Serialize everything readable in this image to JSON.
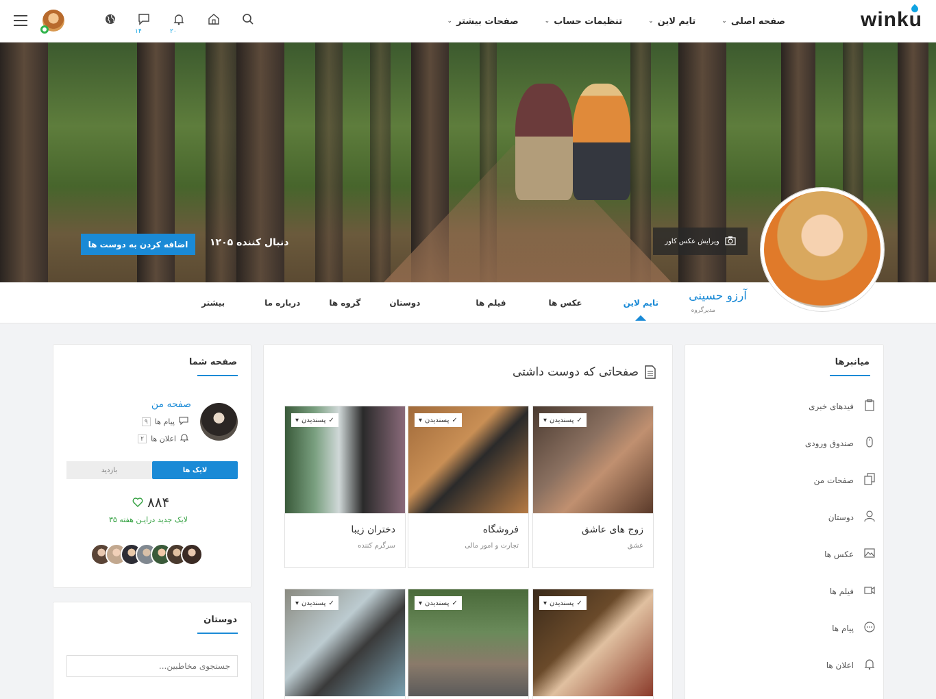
{
  "header": {
    "logo": "winku",
    "nav": [
      {
        "label": "صفحه اصلی"
      },
      {
        "label": "تایم لاین"
      },
      {
        "label": "تنظیمات حساب"
      },
      {
        "label": "صفحات بیشتر"
      }
    ],
    "icons": [
      "search-icon",
      "home-icon",
      "bell-icon",
      "chat-icon",
      "globe-icon"
    ],
    "notification_count": "۲۰",
    "message_count": "۱۴"
  },
  "cover": {
    "followers": "۱۲۰۵ دنبال کننده",
    "add_friend_label": "اضافه کردن به دوست ها",
    "edit_cover_label": "ویرایش عکس کاور"
  },
  "profile": {
    "name": "آرزو حسینی",
    "role": "مدیرگروه",
    "tabs": [
      "تایم لاین",
      "عکس ها",
      "فیلم ها",
      "دوستان",
      "گروه ها",
      "درباره ما",
      "بیشتر"
    ],
    "active_tab": "تایم لاین"
  },
  "your_page": {
    "title": "صفحه شما",
    "my_page_link": "صفحه من",
    "messages_label": "پیام ها",
    "messages_count": "۹",
    "notifications_label": "اعلان ها",
    "notifications_count": "۲",
    "toggle_on": "لایک ها",
    "toggle_off": "بازدید",
    "likes_total": "۸۸۴",
    "likes_new": "۳۵ لایک جدید درایـن هفته"
  },
  "friends": {
    "title": "دوستان",
    "search_placeholder": "جستجوی مخاطبین..."
  },
  "liked_pages": {
    "title": "صفحاتی که دوست داشتی",
    "like_tag": "پسندیدن",
    "pages": [
      {
        "title": "زوج های عاشق",
        "subtitle": "عشق"
      },
      {
        "title": "فروشگاه",
        "subtitle": "تجارت و امور مالی"
      },
      {
        "title": "دختران زیبا",
        "subtitle": "سرگرم کننده"
      },
      {
        "title": "",
        "subtitle": ""
      },
      {
        "title": "",
        "subtitle": ""
      },
      {
        "title": "",
        "subtitle": ""
      }
    ]
  },
  "shortcuts": {
    "title": "میانبرها",
    "items": [
      {
        "label": "فیدهای خبری",
        "icon": "clipboard-icon"
      },
      {
        "label": "صندوق ورودی",
        "icon": "mouse-icon"
      },
      {
        "label": "صفحات من",
        "icon": "copy-icon"
      },
      {
        "label": "دوستان",
        "icon": "user-icon"
      },
      {
        "label": "عکس ها",
        "icon": "image-icon"
      },
      {
        "label": "فیلم ها",
        "icon": "video-icon"
      },
      {
        "label": "پیام ها",
        "icon": "message-icon"
      },
      {
        "label": "اعلان ها",
        "icon": "bell-icon"
      }
    ]
  },
  "colors": {
    "accent": "#1a8ad6",
    "success": "#2e9e3c"
  }
}
